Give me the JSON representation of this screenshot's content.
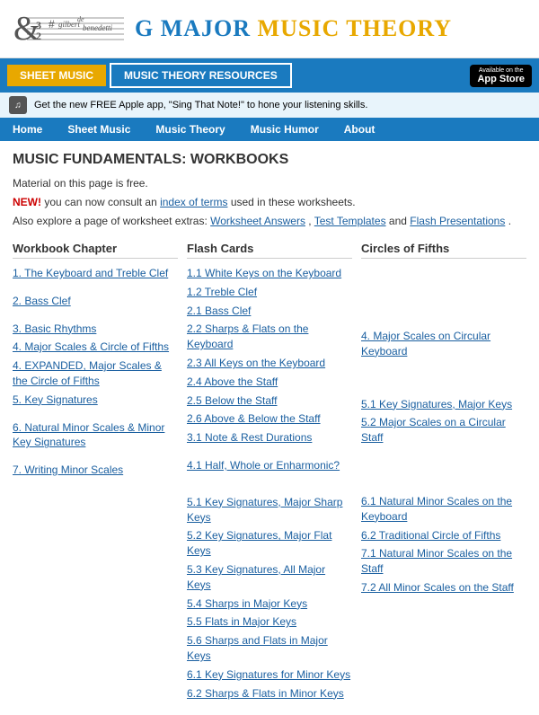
{
  "header": {
    "logo_name1": "gilbert",
    "logo_name2": "de",
    "logo_name3": "benedetti",
    "site_title_blue": "G MAJOR",
    "site_title_orange": "MUSIC THEORY",
    "nav_sheet_music": "SHEET MUSIC",
    "nav_theory": "MUSIC THEORY RESOURCES",
    "appstore_available": "Available on the",
    "appstore_label": "App Store",
    "apple_promo": "Get the new FREE Apple app, \"Sing That Note!\" to hone your listening skills."
  },
  "main_nav": {
    "items": [
      "Home",
      "Sheet Music",
      "Music Theory",
      "Music Humor",
      "About"
    ]
  },
  "content": {
    "page_title": "MUSIC FUNDAMENTALS: WORKBOOKS",
    "free_text": "Material on this page is free.",
    "new_label": "NEW!",
    "new_text": " you can now consult an ",
    "index_link": "index of terms",
    "new_text2": " used in these worksheets.",
    "also_text": "Also  explore a page of worksheet extras: ",
    "extras_link1": "Worksheet Answers",
    "extras_sep": ", ",
    "extras_link2": "Test Templates",
    "extras_text3": " and ",
    "extras_link3": "Flash Presentations",
    "extras_period": "."
  },
  "col1": {
    "header": "Workbook Chapter",
    "items": [
      {
        "label": "1. The Keyboard and Treble Clef",
        "gap_after": true
      },
      {
        "label": "2. Bass Clef",
        "gap_after": true
      },
      {
        "label": "3. Basic Rhythms",
        "gap_after": false
      },
      {
        "label": "4. Major Scales & Circle of Fifths",
        "gap_after": false
      },
      {
        "label": "4. EXPANDED, Major Scales & the Circle of Fifths",
        "gap_after": false
      },
      {
        "label": "5. Key Signatures",
        "gap_after": true
      },
      {
        "label": "6. Natural Minor Scales & Minor Key Signatures",
        "gap_after": true
      },
      {
        "label": "7. Writing Minor Scales",
        "gap_after": false
      }
    ]
  },
  "col2": {
    "header": "Flash Cards",
    "items": [
      {
        "label": "1.1 White Keys on the Keyboard"
      },
      {
        "label": "1.2 Treble Clef"
      },
      {
        "label": "2.1 Bass Clef"
      },
      {
        "label": "2.2 Sharps & Flats on the Keyboard"
      },
      {
        "label": "2.3 All Keys on the Keyboard"
      },
      {
        "label": "2.4 Above the Staff"
      },
      {
        "label": "2.5 Below the Staff"
      },
      {
        "label": "2.6 Above & Below the Staff"
      },
      {
        "label": "3.1 Note & Rest Durations"
      },
      {
        "label": ""
      },
      {
        "label": "4.1 Half, Whole or Enharmonic?"
      },
      {
        "label": ""
      },
      {
        "label": ""
      },
      {
        "label": "5.1 Key Signatures, Major Sharp Keys"
      },
      {
        "label": "5.2 Key Signatures, Major Flat Keys"
      },
      {
        "label": "5.3 Key Signatures, All Major Keys"
      },
      {
        "label": "5.4 Sharps in Major Keys"
      },
      {
        "label": "5.5 Flats in Major Keys"
      },
      {
        "label": "5.6 Sharps and Flats in Major Keys"
      },
      {
        "label": "6.1 Key Signatures for Minor Keys"
      },
      {
        "label": "6.2 Sharps & Flats in Minor Keys"
      }
    ]
  },
  "col3": {
    "header": "Circles of Fifths",
    "items": [
      {
        "label": ""
      },
      {
        "label": ""
      },
      {
        "label": ""
      },
      {
        "label": ""
      },
      {
        "label": "4. Major Scales on Circular Keyboard"
      },
      {
        "label": ""
      },
      {
        "label": ""
      },
      {
        "label": "5.1 Key Signatures, Major Keys"
      },
      {
        "label": "5.2 Major Scales on a Circular Staff"
      },
      {
        "label": ""
      },
      {
        "label": ""
      },
      {
        "label": ""
      },
      {
        "label": "6.1 Natural Minor Scales on the Keyboard"
      },
      {
        "label": "6.2 Traditional Circle of Fifths"
      },
      {
        "label": "7.1 Natural Minor Scales on the Staff"
      },
      {
        "label": "7.2 All Minor Scales on the Staff"
      }
    ]
  }
}
